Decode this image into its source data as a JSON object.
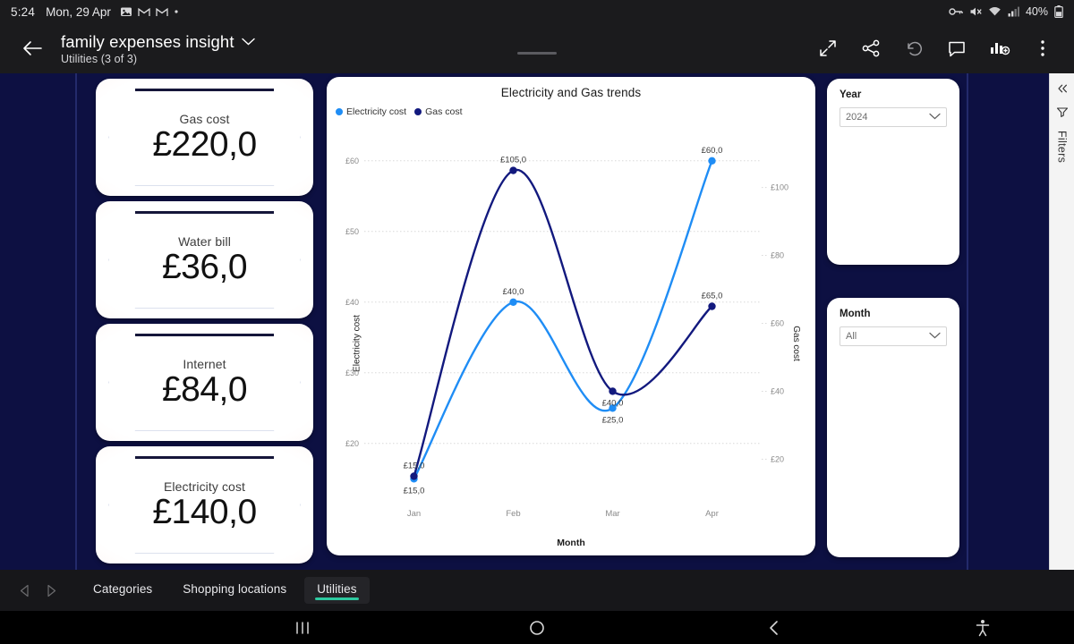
{
  "statusbar": {
    "time": "5:24",
    "date": "Mon, 29 Apr",
    "battery": "40%",
    "icons_left": [
      "screenshot-icon",
      "gmail-icon",
      "gmail-icon",
      "dot-icon"
    ],
    "icons_right": [
      "vpn-key-icon",
      "mute-icon",
      "wifi-icon",
      "signal-icon",
      "battery-icon"
    ]
  },
  "appbar": {
    "back": "back-arrow",
    "title": "family expenses insight",
    "subtitle": "Utilities  (3 of 3)",
    "actions": [
      "fullscreen-icon",
      "share-icon",
      "undo-icon",
      "comment-icon",
      "insights-icon",
      "more-icon"
    ]
  },
  "kpis": [
    {
      "label": "Gas cost",
      "value": "£220,0"
    },
    {
      "label": "Water bill",
      "value": "£36,0"
    },
    {
      "label": "Internet",
      "value": "£84,0"
    },
    {
      "label": "Electricity cost",
      "value": "£140,0"
    }
  ],
  "chart_data": {
    "type": "line",
    "title": "Electricity and Gas trends",
    "xlabel": "Month",
    "ylabel": "Electricity cost",
    "y2label": "Gas cost",
    "categories": [
      "Jan",
      "Feb",
      "Mar",
      "Apr"
    ],
    "grid": true,
    "legend_position": "top-left",
    "series": [
      {
        "name": "Electricity cost",
        "color": "#1f8df5",
        "axis": "left",
        "values": [
          15,
          40,
          25,
          60
        ],
        "labels": [
          "£15,0",
          "£40,0",
          "£25,0",
          "£60,0"
        ]
      },
      {
        "name": "Gas cost",
        "color": "#12197e",
        "axis": "right",
        "values": [
          15,
          105,
          40,
          65
        ],
        "labels": [
          "£15,0",
          "£105,0",
          "£40,0",
          "£65,0"
        ]
      }
    ],
    "left_axis": {
      "label": "Electricity cost",
      "ticks": [
        "£20",
        "£30",
        "£40",
        "£50",
        "£60"
      ],
      "tick_values": [
        20,
        30,
        40,
        50,
        60
      ],
      "ylim": [
        12,
        62
      ]
    },
    "right_axis": {
      "label": "Gas cost",
      "ticks": [
        "£20",
        "£40",
        "£60",
        "£80",
        "£100"
      ],
      "tick_values": [
        20,
        40,
        60,
        80,
        100
      ],
      "ylim": [
        8,
        112
      ]
    }
  },
  "slicers": [
    {
      "title": "Year",
      "value": "2024"
    },
    {
      "title": "Month",
      "value": "All"
    }
  ],
  "filters_rail": {
    "collapse_icon": "chevron-double-left-icon",
    "filter_icon": "filter-icon",
    "label": "Filters"
  },
  "tabs": [
    {
      "label": "Categories",
      "active": false
    },
    {
      "label": "Shopping locations",
      "active": false
    },
    {
      "label": "Utilities",
      "active": true
    }
  ],
  "navbar": {
    "recent": "recents-icon",
    "home": "home-icon",
    "back": "back-icon",
    "accessibility": "accessibility-icon"
  },
  "colors": {
    "canvas_bg": "#0d1042",
    "electricity": "#1f8df5",
    "gas": "#12197e",
    "tab_accent": "#2dc9a0"
  }
}
